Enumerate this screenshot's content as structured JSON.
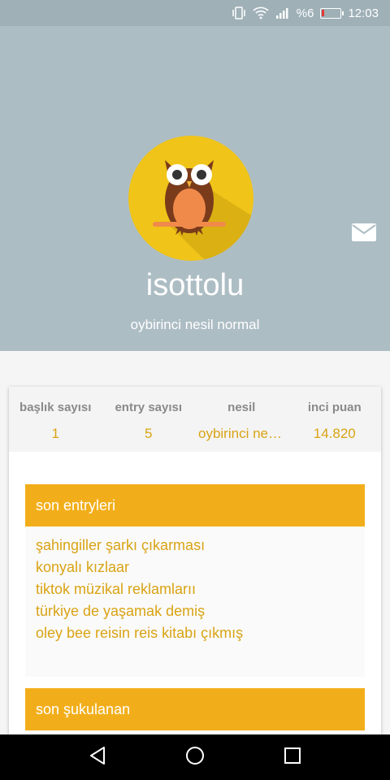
{
  "status_bar": {
    "battery_percent": "%6",
    "time": "12:03",
    "icons": [
      "vibrate-icon",
      "wifi-icon",
      "signal-icon",
      "battery-icon"
    ]
  },
  "profile": {
    "username": "isottolu",
    "title": "oybirinci nesil normal",
    "avatar_icon": "owl-icon",
    "message_icon": "mail-icon"
  },
  "stats": [
    {
      "label": "başlık sayısı",
      "value": "1"
    },
    {
      "label": "entry sayısı",
      "value": "5"
    },
    {
      "label": "nesil",
      "value": "oybirinci nesi..."
    },
    {
      "label": "inci puan",
      "value": "14.820"
    }
  ],
  "sections": {
    "recent_entries": {
      "title": "son entryleri",
      "items": [
        "şahingiller şarkı çıkarması",
        "konyalı kızlaar",
        "tiktok müzikal reklamlarıı",
        "türkiye de yaşamak demiş",
        "oley bee reisin reis kitabı çıkmış"
      ]
    },
    "recent_liked": {
      "title": "son şukulanan"
    }
  },
  "nav": {
    "back_icon": "back-triangle-icon",
    "home_icon": "home-circle-icon",
    "recents_icon": "recents-square-icon"
  },
  "colors": {
    "header_bg": "#adbdc4",
    "accent": "#f2ae1a",
    "accent_text": "#d9a314"
  }
}
